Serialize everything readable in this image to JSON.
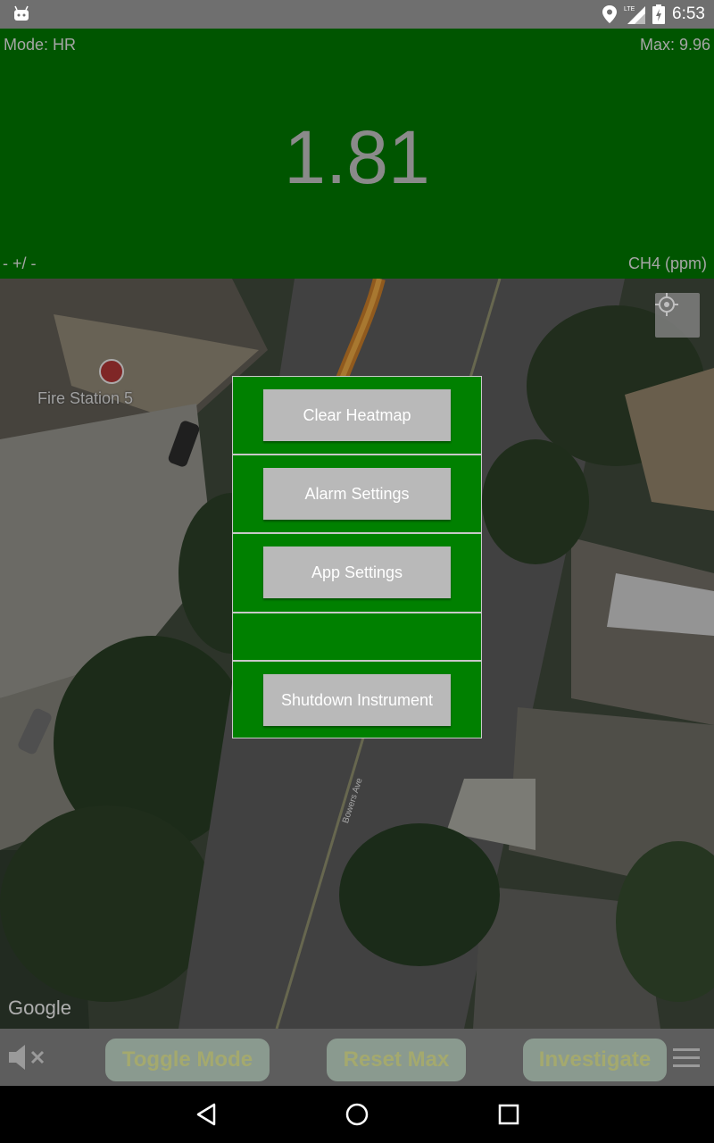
{
  "status_bar": {
    "time": "6:53",
    "icons": [
      "android-icon",
      "location-icon",
      "lte-signal-icon",
      "battery-icon"
    ]
  },
  "reading": {
    "mode": "Mode: HR",
    "max": "Max: 9.96",
    "value": "1.81",
    "delta": "- +/ -",
    "unit": "CH4 (ppm)"
  },
  "map": {
    "place_label": "Fire Station 5",
    "street_label": "Bowers Ave",
    "attribution": "Google"
  },
  "menu": {
    "items": [
      {
        "label": "Clear Heatmap"
      },
      {
        "label": "Alarm Settings"
      },
      {
        "label": "App Settings"
      },
      {
        "label": "Shutdown Instrument"
      }
    ]
  },
  "toolbar": {
    "toggle_mode": "Toggle Mode",
    "reset_max": "Reset Max",
    "investigate": "Investigate"
  },
  "colors": {
    "reading_bg": "#005500",
    "menu_bg": "#008000",
    "button_bg": "#b9b9b9"
  }
}
